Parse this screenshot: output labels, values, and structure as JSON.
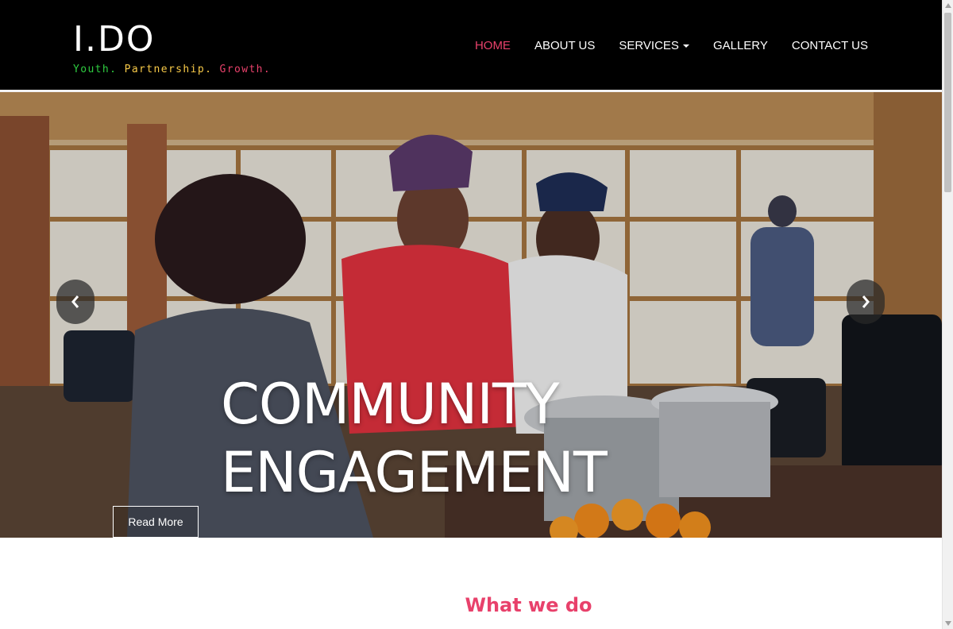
{
  "brand": {
    "title": "I.DO",
    "tagline": [
      {
        "text": "Youth. ",
        "color": "#2ecc40"
      },
      {
        "text": "Partnership. ",
        "color": "#f7c948"
      },
      {
        "text": "Growth.",
        "color": "#e8416b"
      }
    ]
  },
  "nav": {
    "items": [
      {
        "label": "HOME",
        "active": true,
        "dropdown": false
      },
      {
        "label": "ABOUT US",
        "active": false,
        "dropdown": false
      },
      {
        "label": "SERVICES",
        "active": false,
        "dropdown": true
      },
      {
        "label": "GALLERY",
        "active": false,
        "dropdown": false
      },
      {
        "label": "CONTACT US",
        "active": false,
        "dropdown": false
      }
    ]
  },
  "hero": {
    "caption_line1": "COMMUNITY",
    "caption_line2": "ENGAGEMENT",
    "read_more_label": "Read More",
    "prev_icon": "chevron-left-icon",
    "next_icon": "chevron-right-icon"
  },
  "section": {
    "heading": "What we do"
  },
  "colors": {
    "accent": "#e8416b",
    "header_bg": "#000000",
    "text_light": "#ffffff"
  }
}
